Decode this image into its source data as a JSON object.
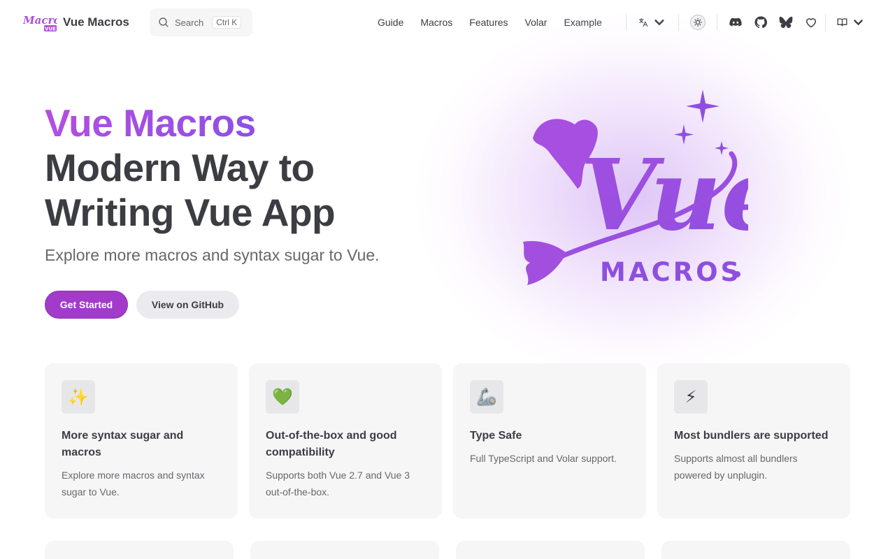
{
  "nav": {
    "title": "Vue Macros",
    "logo_text": "Macros",
    "logo_sub": "VUE",
    "search_label": "Search",
    "search_shortcut": "Ctrl K",
    "links": [
      "Guide",
      "Macros",
      "Features",
      "Volar",
      "Example"
    ],
    "icons": [
      "translate-icon",
      "theme-toggle-icon",
      "discord-icon",
      "github-icon",
      "bluesky-icon",
      "sponsor-heart-icon",
      "book-icon"
    ]
  },
  "hero": {
    "name": "Vue Macros",
    "text": "Modern Way to Writing Vue App",
    "tagline": "Explore more macros and syntax sugar to Vue.",
    "primary_action": "Get Started",
    "secondary_action": "View on GitHub",
    "logo_script": "Vue",
    "logo_word": "MACROS"
  },
  "features": [
    {
      "icon": "✨",
      "title": "More syntax sugar and macros",
      "details": "Explore more macros and syntax sugar to Vue."
    },
    {
      "icon": "💚",
      "title": "Out-of-the-box and good compatibility",
      "details": "Supports both Vue 2.7 and Vue 3 out-of-the-box."
    },
    {
      "icon": "🦾",
      "title": "Type Safe",
      "details": "Full TypeScript and Volar support."
    },
    {
      "icon": "⚡",
      "title": "Most bundlers are supported",
      "details": "Supports almost all bundlers powered by unplugin."
    }
  ],
  "colors": {
    "brand": "#a23bc9",
    "brand_gradient_start": "#b34fe0",
    "brand_gradient_end": "#8d4fe6",
    "card_bg": "#f6f6f7"
  }
}
